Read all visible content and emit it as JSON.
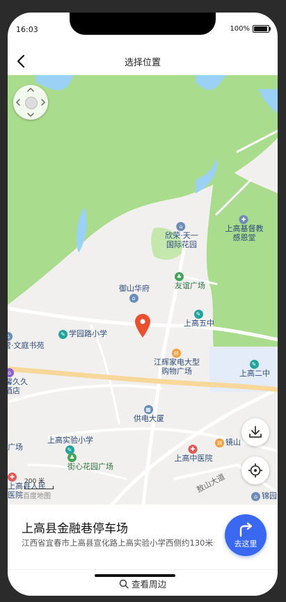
{
  "status": {
    "time": "16:03",
    "battery": "100%"
  },
  "nav": {
    "title": "选择位置",
    "back_icon": "chevron-left-icon"
  },
  "map": {
    "pois": [
      {
        "id": "xinrong",
        "label": "欣荣·天一\n国际花园"
      },
      {
        "id": "jidu",
        "label": "上高基督教\n感恩堂"
      },
      {
        "id": "youyi",
        "label": "友谊广场"
      },
      {
        "id": "yushan",
        "label": "御山华府"
      },
      {
        "id": "wuzhong",
        "label": "上高五中"
      },
      {
        "id": "xueyuan",
        "label": "学园路小学"
      },
      {
        "id": "wenting",
        "label": "营·文庭书苑"
      },
      {
        "id": "jianghui",
        "label": "江辉家电大型\n购物广场"
      },
      {
        "id": "erzhong",
        "label": "上高二中"
      },
      {
        "id": "jiujiu",
        "label": "馨久久\n酒店"
      },
      {
        "id": "gongdian",
        "label": "供电大厦"
      },
      {
        "id": "shiyan",
        "label": "上高实验小学"
      },
      {
        "id": "jiexin",
        "label": "街心花园广场"
      },
      {
        "id": "zhongyi",
        "label": "上高中医院"
      },
      {
        "id": "jingshan",
        "label": "镜山"
      },
      {
        "id": "renmin",
        "label": "上高县人民\n医院"
      },
      {
        "id": "aoshan",
        "label": "敖山大道"
      },
      {
        "id": "jinyuan",
        "label": "锦园"
      },
      {
        "id": "chang",
        "label": "广场"
      }
    ],
    "scale_label": "200 米",
    "logo_text": "百度地图",
    "locate_icon": "locate-icon",
    "download_icon": "download-icon",
    "compass_icon": "compass-icon"
  },
  "place": {
    "name": "上高县金融巷停车场",
    "address": "江西省宜春市上高县宣化路上高实验小学西侧约130米",
    "go_label": "去这里"
  },
  "footer": {
    "nearby_label": "查看周边"
  }
}
